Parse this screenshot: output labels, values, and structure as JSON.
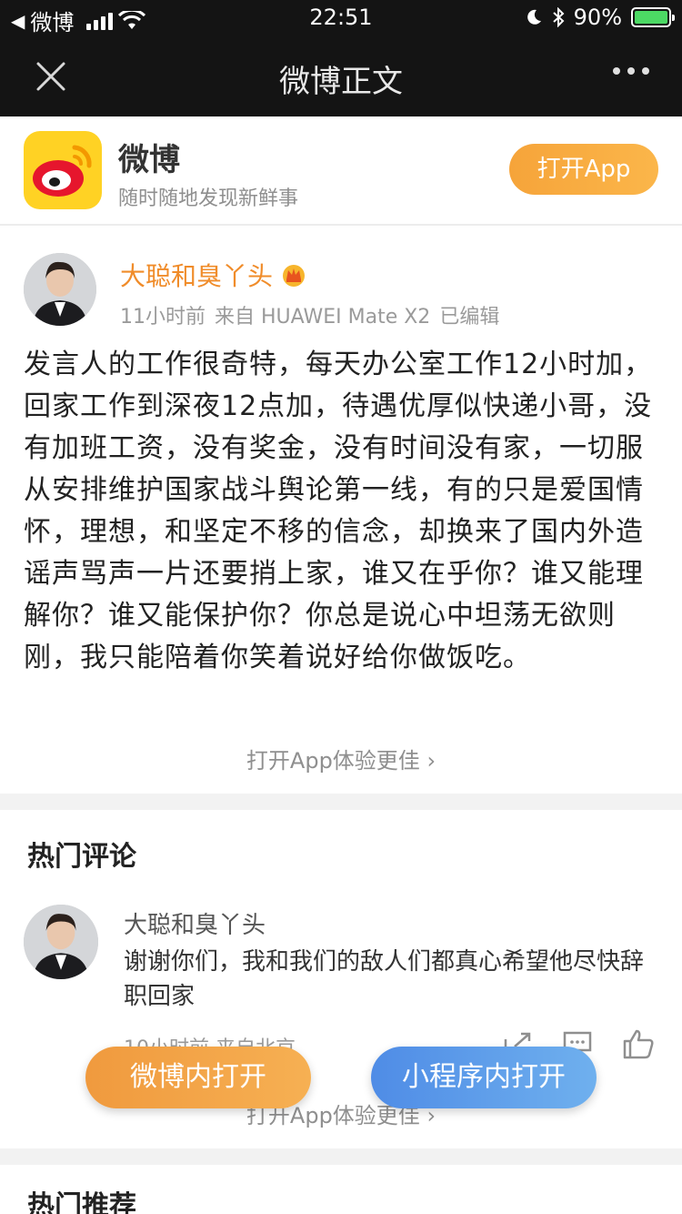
{
  "status_bar": {
    "back_app": "微博",
    "time": "22:51",
    "battery": "90%"
  },
  "nav": {
    "title": "微博正文",
    "close_icon": "close-icon",
    "more_icon": "more-icon"
  },
  "banner": {
    "app_name": "微博",
    "slogan": "随时随地发现新鲜事",
    "open_button": "打开App"
  },
  "post": {
    "author": "大聪和臭丫头",
    "time": "11小时前",
    "source": "来自 HUAWEI Mate X2",
    "edited": "已编辑",
    "text": "发言人的工作很奇特，每天办公室工作12小时加，回家工作到深夜12点加，待遇优厚似快递小哥，没有加班工资，没有奖金，没有时间没有家，一切服从安排维护国家战斗舆论第一线，有的只是爱国情怀，理想，和坚定不移的信念，却换来了国内外造谣声骂声一片还要捎上家，谁又在乎你？谁又能理解你？谁又能保护你？你总是说心中坦荡无欲则刚，我只能陪着你笑着说好给你做饭吃。",
    "open_more": "打开App体验更佳"
  },
  "comments": {
    "title": "热门评论",
    "items": [
      {
        "author": "大聪和臭丫头",
        "text": "谢谢你们，我和我们的敌人们都真心希望他尽快辞职回家",
        "meta": "10小时前 来自北京"
      }
    ],
    "open_more": "打开App体验更佳"
  },
  "recommend": {
    "title": "热门推荐"
  },
  "floating": {
    "open_in_weibo": "微博内打开",
    "open_in_miniprogram": "小程序内打开"
  },
  "colors": {
    "accent_orange": "#f6a43a",
    "accent_blue": "#4f8ce6",
    "author_orange": "#f08c2a"
  }
}
